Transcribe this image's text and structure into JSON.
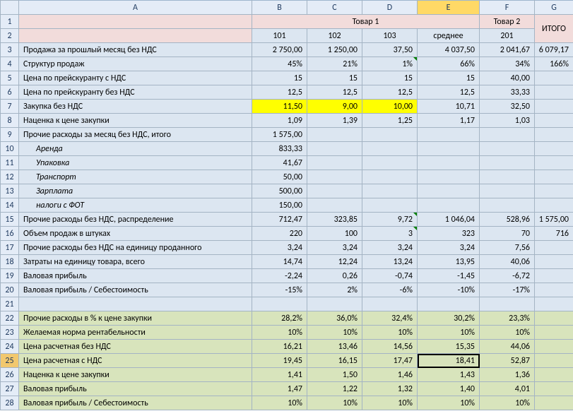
{
  "columns": [
    "A",
    "B",
    "C",
    "D",
    "E",
    "F",
    "G"
  ],
  "group_headers": {
    "tovar1": "Товар 1",
    "tovar2": "Товар 2",
    "itogo": "ИТОГО"
  },
  "sub_headers": {
    "c101": "101",
    "c102": "102",
    "c103": "103",
    "avg": "среднее",
    "c201": "201"
  },
  "rows": {
    "3": {
      "label": "Продажа за прошлый месяц без НДС",
      "B": "2 750,00",
      "C": "1 250,00",
      "D": "37,50",
      "E": "4 037,50",
      "F": "2 041,67",
      "G": "6 079,17"
    },
    "4": {
      "label": "Структур продаж",
      "B": "45%",
      "C": "21%",
      "D": "1%",
      "E": "66%",
      "F": "34%",
      "G": "166%"
    },
    "5": {
      "label": "Цена по прейскуранту с НДС",
      "B": "15",
      "C": "15",
      "D": "15",
      "E": "15",
      "F": "40,00",
      "G": ""
    },
    "6": {
      "label": "Цена по прейскуранту без НДС",
      "B": "12,5",
      "C": "12,5",
      "D": "12,5",
      "E": "12,5",
      "F": "33,33",
      "G": ""
    },
    "7": {
      "label": "Закупка без НДС",
      "B": "11,50",
      "C": "9,00",
      "D": "10,00",
      "E": "10,71",
      "F": "32,50",
      "G": ""
    },
    "8": {
      "label": "Наценка к цене закупки",
      "B": "1,09",
      "C": "1,39",
      "D": "1,25",
      "E": "1,17",
      "F": "1,03",
      "G": ""
    },
    "9": {
      "label": "Прочие расходы за месяц без НДС, итого",
      "B": "1 575,00",
      "C": "",
      "D": "",
      "E": "",
      "F": "",
      "G": ""
    },
    "10": {
      "label": "Аренда",
      "B": "833,33",
      "C": "",
      "D": "",
      "E": "",
      "F": "",
      "G": ""
    },
    "11": {
      "label": "Упаковка",
      "B": "41,67",
      "C": "",
      "D": "",
      "E": "",
      "F": "",
      "G": ""
    },
    "12": {
      "label": "Транспорт",
      "B": "50,00",
      "C": "",
      "D": "",
      "E": "",
      "F": "",
      "G": ""
    },
    "13": {
      "label": "Зарплата",
      "B": "500,00",
      "C": "",
      "D": "",
      "E": "",
      "F": "",
      "G": ""
    },
    "14": {
      "label": "налоги с ФОТ",
      "B": "150,00",
      "C": "",
      "D": "",
      "E": "",
      "F": "",
      "G": ""
    },
    "15": {
      "label": "Прочие расходы без НДС, распределение",
      "B": "712,47",
      "C": "323,85",
      "D": "9,72",
      "E": "1 046,04",
      "F": "528,96",
      "G": "1 575,00"
    },
    "16": {
      "label": "Объем продаж в штуках",
      "B": "220",
      "C": "100",
      "D": "3",
      "E": "323",
      "F": "70",
      "G": "716"
    },
    "17": {
      "label": "Прочие расходы без НДС на единицу проданного",
      "B": "3,24",
      "C": "3,24",
      "D": "3,24",
      "E": "3,24",
      "F": "7,56",
      "G": ""
    },
    "18": {
      "label": "Затраты на единицу товара, всего",
      "B": "14,74",
      "C": "12,24",
      "D": "13,24",
      "E": "13,95",
      "F": "40,06",
      "G": ""
    },
    "19": {
      "label": "Валовая прибыль",
      "B": "-2,24",
      "C": "0,26",
      "D": "-0,74",
      "E": "-1,45",
      "F": "-6,72",
      "G": ""
    },
    "20": {
      "label": "Валовая прибыль / Себестоимость",
      "B": "-15%",
      "C": "2%",
      "D": "-6%",
      "E": "-10%",
      "F": "-17%",
      "G": ""
    },
    "21": {
      "label": "",
      "B": "",
      "C": "",
      "D": "",
      "E": "",
      "F": "",
      "G": ""
    },
    "22": {
      "label": "Прочие расходы в % к цене закупки",
      "B": "28,2%",
      "C": "36,0%",
      "D": "32,4%",
      "E": "30,2%",
      "F": "23,3%",
      "G": ""
    },
    "23": {
      "label": "Желаемая норма рентабельности",
      "B": "10%",
      "C": "10%",
      "D": "10%",
      "E": "10%",
      "F": "10%",
      "G": ""
    },
    "24": {
      "label": "Цена расчетная без НДС",
      "B": "16,21",
      "C": "13,46",
      "D": "14,56",
      "E": "15,35",
      "F": "44,06",
      "G": ""
    },
    "25": {
      "label": "Цена расчетная с НДС",
      "B": "19,45",
      "C": "16,15",
      "D": "17,47",
      "E": "18,41",
      "F": "52,87",
      "G": ""
    },
    "26": {
      "label": "Наценка к цене закупки",
      "B": "1,41",
      "C": "1,50",
      "D": "1,46",
      "E": "1,43",
      "F": "1,36",
      "G": ""
    },
    "27": {
      "label": "Валовая прибыль",
      "B": "1,47",
      "C": "1,22",
      "D": "1,32",
      "E": "1,40",
      "F": "4,01",
      "G": ""
    },
    "28": {
      "label": "Валовая прибыль / Себестоимость",
      "B": "10%",
      "C": "10%",
      "D": "10%",
      "E": "10%",
      "F": "10%",
      "G": ""
    }
  },
  "indent_rows": [
    "10",
    "11",
    "12",
    "13",
    "14"
  ],
  "green_rows": [
    "22",
    "23",
    "24",
    "25",
    "26",
    "27",
    "28"
  ],
  "yellow_cells": [
    "7B",
    "7C",
    "7D"
  ],
  "triangle_cells": [
    "4D",
    "15D",
    "16D"
  ],
  "selected_cell": "25E",
  "active_col": "E"
}
